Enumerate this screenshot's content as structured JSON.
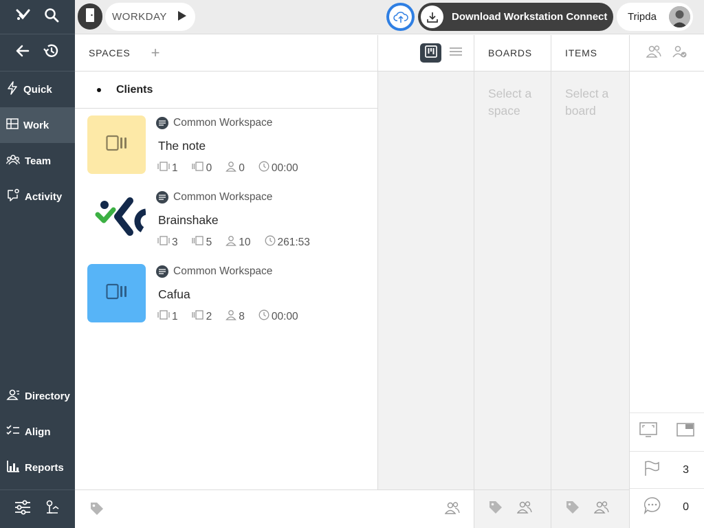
{
  "sidebar": {
    "items": [
      {
        "label": "Quick",
        "icon": "lightning-icon"
      },
      {
        "label": "Work",
        "icon": "board-icon",
        "active": true
      },
      {
        "label": "Team",
        "icon": "team-icon"
      },
      {
        "label": "Activity",
        "icon": "chat-bubble-icon"
      }
    ],
    "bottom_items": [
      {
        "label": "Directory",
        "icon": "directory-icon"
      },
      {
        "label": "Align",
        "icon": "checklist-icon"
      },
      {
        "label": "Reports",
        "icon": "bar-chart-icon"
      }
    ]
  },
  "topbar": {
    "workspace_label": "WORKDAY",
    "download_label": "Download Workstation Connect",
    "user_name": "Tripda"
  },
  "spaces": {
    "header": "SPACES",
    "group": "Clients",
    "items": [
      {
        "workspace": "Common Workspace",
        "name": "The note",
        "boards": "1",
        "items": "0",
        "members": "0",
        "time": "00:00",
        "color": "#fde9a7"
      },
      {
        "workspace": "Common Workspace",
        "name": "Brainshake",
        "boards": "3",
        "items": "5",
        "members": "10",
        "time": "261:53",
        "color": "#ffffff"
      },
      {
        "workspace": "Common Workspace",
        "name": "Cafua",
        "boards": "1",
        "items": "2",
        "members": "8",
        "time": "00:00",
        "color": "#57b4f7"
      }
    ]
  },
  "boards": {
    "header": "BOARDS",
    "empty": "Select a space"
  },
  "items": {
    "header": "ITEMS",
    "empty": "Select a board"
  },
  "right_panel": {
    "flag_count": "3",
    "comment_count": "0"
  }
}
